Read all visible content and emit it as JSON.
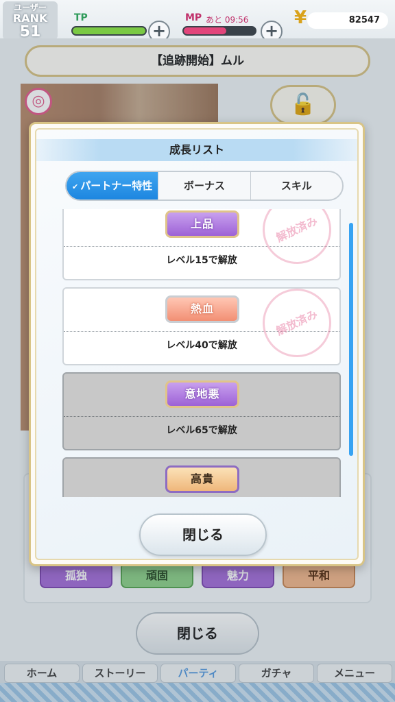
{
  "status": {
    "rank_label_1": "ユーザー",
    "rank_label_2": "RANK",
    "rank_value": "51",
    "tp_label": "TP",
    "mp_label": "MP",
    "mp_timer": "あと 09:56",
    "plus": "+",
    "money": "82547",
    "tp_fill": 1.0,
    "mp_fill": 0.6
  },
  "sheet": {
    "title": "【追跡開始】ムル",
    "traits": [
      "孤独",
      "頑固",
      "魅力",
      "平和"
    ],
    "close_label": "閉じる"
  },
  "nav": {
    "items": [
      "ホーム",
      "ストーリー",
      "パーティ",
      "ガチャ",
      "メニュー"
    ]
  },
  "modal": {
    "title": "成長リスト",
    "tabs": [
      {
        "label": "パートナー特性",
        "active": true
      },
      {
        "label": "ボーナス",
        "active": false
      },
      {
        "label": "スキル",
        "active": false
      }
    ],
    "cards": [
      {
        "trait": "上品",
        "unlock": "レベル15で解放",
        "state": "unlocked"
      },
      {
        "trait": "熱血",
        "unlock": "レベル40で解放",
        "state": "unlocked"
      },
      {
        "trait": "意地悪",
        "unlock": "レベル65で解放",
        "state": "locked"
      },
      {
        "trait": "高貴",
        "unlock": "",
        "state": "locked"
      }
    ],
    "stamp_text": "解放済み",
    "close_label": "閉じる"
  },
  "colors": {
    "tab_active": "#1d86e0",
    "frame_gold": "#d8c486",
    "scrollbar": "#37a3f2"
  }
}
